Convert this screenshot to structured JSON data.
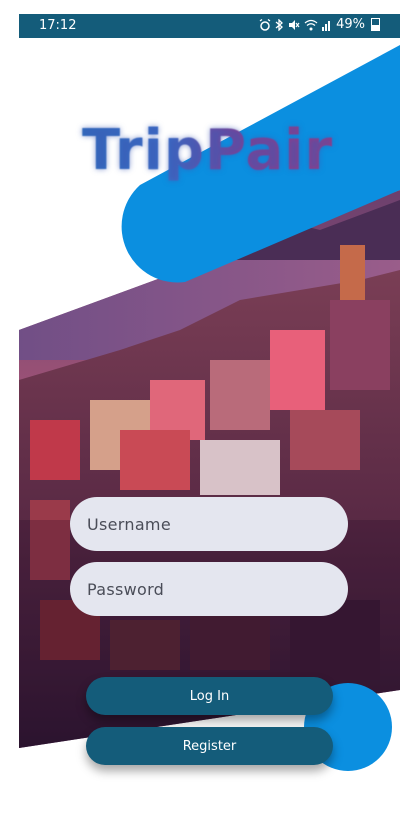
{
  "status_bar": {
    "time": "17:12",
    "battery": "49%",
    "icons": [
      "alarm-icon",
      "bluetooth-icon",
      "mute-icon",
      "wifi-icon",
      "signal-icon",
      "battery-icon"
    ]
  },
  "app": {
    "title": "TripPair"
  },
  "form": {
    "username_placeholder": "Username",
    "password_placeholder": "Password"
  },
  "buttons": {
    "login_label": "Log In",
    "register_label": "Register"
  },
  "colors": {
    "accent_blue": "#0b8fe0",
    "primary_teal": "#145c7a",
    "field_bg": "#e4e6ef"
  }
}
